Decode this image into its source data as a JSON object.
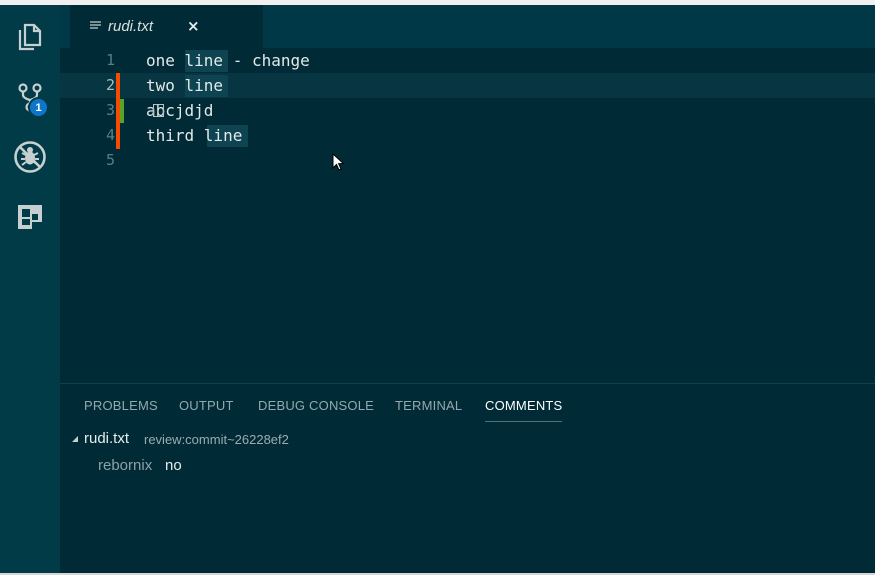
{
  "activity_bar": {
    "items": [
      {
        "name": "explorer",
        "icon": "files-icon"
      },
      {
        "name": "source-control",
        "icon": "source-control-icon",
        "badge": "1"
      },
      {
        "name": "debug",
        "icon": "no-bug-icon"
      },
      {
        "name": "extensions",
        "icon": "extensions-icon"
      }
    ]
  },
  "tabs": [
    {
      "label": "rudi.txt",
      "icon": "text-file-icon",
      "close": "×"
    }
  ],
  "editor": {
    "lines": [
      {
        "number": "1",
        "text": "one line - change"
      },
      {
        "number": "2",
        "text": "two line"
      },
      {
        "number": "3",
        "text": "abcjdjd"
      },
      {
        "number": "4",
        "text": "third line"
      },
      {
        "number": "5",
        "text": ""
      }
    ],
    "gutter_colors": {
      "modified": "#f44d01",
      "added": "#56a42a"
    }
  },
  "panel": {
    "tabs": [
      "PROBLEMS",
      "OUTPUT",
      "DEBUG CONSOLE",
      "TERMINAL",
      "COMMENTS"
    ],
    "active_tab": "COMMENTS",
    "thread": {
      "file": "rudi.txt",
      "description": "review:commit~26228ef2",
      "comments": [
        {
          "author": "rebornix",
          "body": "no"
        }
      ]
    }
  }
}
